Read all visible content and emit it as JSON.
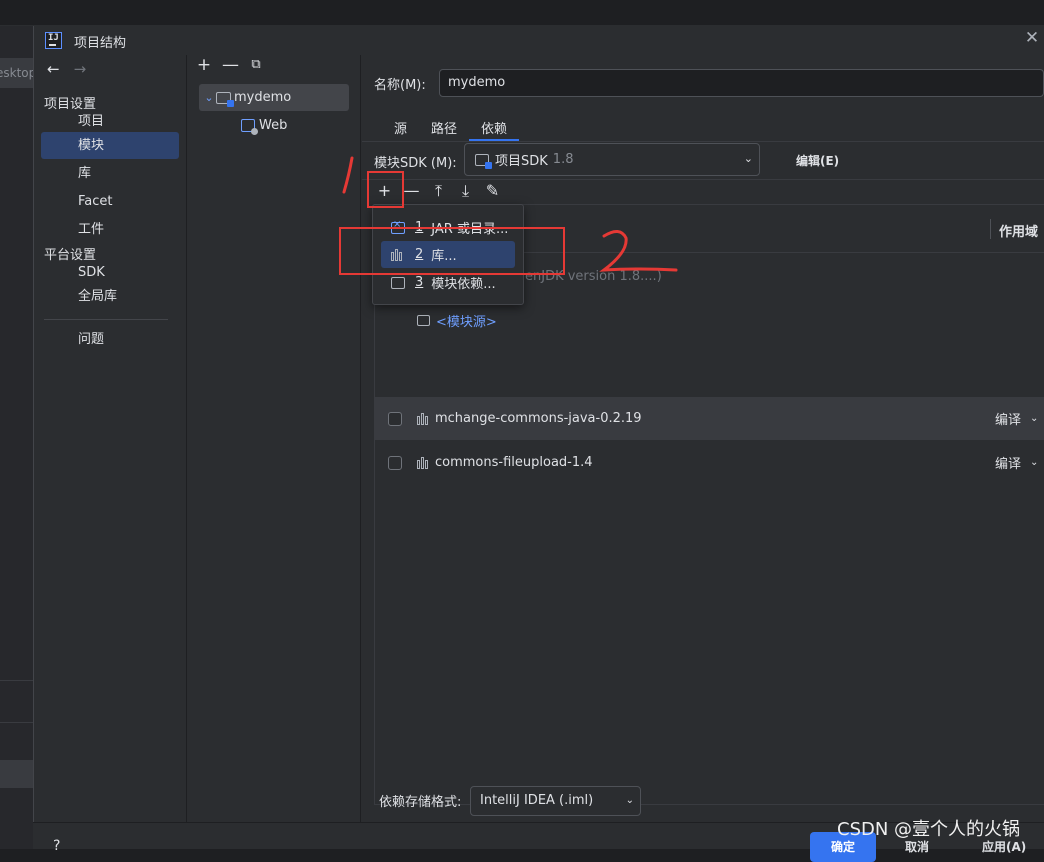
{
  "background": {
    "left_tab_text": "esktop"
  },
  "dialog": {
    "title": "项目结构",
    "close_icon": "close-icon",
    "app_icon_text": "IJ"
  },
  "leftnav": {
    "back": "←",
    "forward": "→",
    "section_project": "项目设置",
    "items_project": [
      "项目",
      "模块",
      "库",
      "Facet",
      "工件"
    ],
    "selected": "模块",
    "section_platform": "平台设置",
    "items_platform": [
      "SDK",
      "全局库"
    ],
    "problems": "问题"
  },
  "tree": {
    "tools": [
      "+",
      "—",
      "⧉"
    ],
    "module": "mydemo",
    "child": "Web"
  },
  "main": {
    "name_label": "名称(M):",
    "name_value": "mydemo",
    "tabs": [
      "源",
      "路径",
      "依赖"
    ],
    "active_tab": "依赖",
    "sdk_label": "模块SDK (M):",
    "sdk_value": "项目SDK",
    "sdk_version": "1.8",
    "edit_label": "编辑(E)",
    "dep_tools": [
      "+",
      "—",
      "⤒",
      "⤓",
      "✎"
    ],
    "scope_header": "作用域",
    "sdk_row_text": "enJDK version 1.8....)",
    "module_source": "<模块源>",
    "libraries": [
      {
        "name": "mchange-commons-java-0.2.19",
        "scope": "编译",
        "highlighted": true
      },
      {
        "name": "commons-fileupload-1.4",
        "scope": "编译",
        "highlighted": false
      }
    ]
  },
  "popup": {
    "items": [
      {
        "mnemonic": "1",
        "label": "JAR 或目录..."
      },
      {
        "mnemonic": "2",
        "label": "库..."
      },
      {
        "mnemonic": "3",
        "label": "模块依赖..."
      }
    ],
    "selected_index": 1
  },
  "bottom": {
    "format_label": "依赖存储格式:",
    "format_value": "IntelliJ IDEA (.iml)",
    "help": "?",
    "ok": "确定",
    "cancel": "取消",
    "apply": "应用(A)",
    "watermark": "CSDN @壹个人的火锅"
  },
  "colors": {
    "accent": "#3574f0",
    "selection": "#2e436e",
    "annotation": "#e53935"
  }
}
